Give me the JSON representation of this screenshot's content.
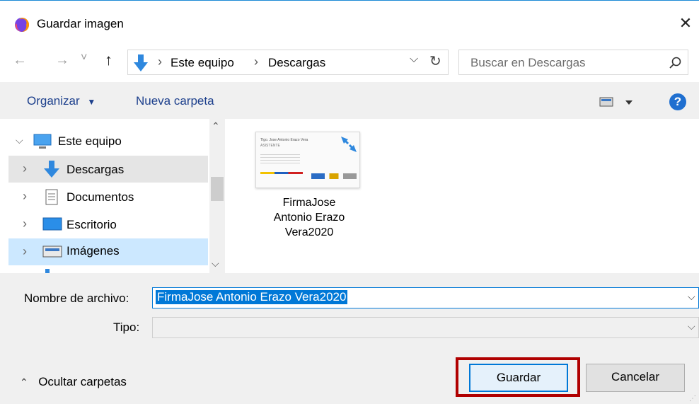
{
  "window": {
    "title": "Guardar imagen",
    "close": "✕"
  },
  "nav": {
    "back": "←",
    "forward": "→",
    "history": "˅",
    "up": "↑",
    "breadcrumb": [
      "Este equipo",
      "Descargas"
    ],
    "sep": "›",
    "dropdown": "⌵",
    "refresh": "↻",
    "search_placeholder": "Buscar en Descargas"
  },
  "toolbar": {
    "organize": "Organizar",
    "new_folder": "Nueva carpeta",
    "help": "?"
  },
  "sidebar": {
    "items": [
      {
        "label": "Este equipo",
        "icon": "computer-icon"
      },
      {
        "label": "Descargas",
        "icon": "download-arrow-icon"
      },
      {
        "label": "Documentos",
        "icon": "document-icon"
      },
      {
        "label": "Escritorio",
        "icon": "desktop-icon"
      },
      {
        "label": "Imágenes",
        "icon": "pictures-icon"
      }
    ]
  },
  "content": {
    "file_name_lines": [
      "FirmaJose",
      "Antonio Erazo",
      "Vera2020"
    ],
    "thumb_lines": [
      "Tlgo. Jose Antonio Erazo Vera",
      "ASISTENTE"
    ]
  },
  "form": {
    "filename_label": "Nombre de archivo:",
    "filename_value": "FirmaJose Antonio Erazo Vera2020",
    "type_label": "Tipo:",
    "type_value": ""
  },
  "footer": {
    "hide_folders": "Ocultar carpetas",
    "save": "Guardar",
    "cancel": "Cancelar"
  },
  "colors": {
    "accent": "#0078d7",
    "highlight_box": "#b00000",
    "selection": "#cce8ff",
    "link_blue": "#1c3f8c"
  }
}
